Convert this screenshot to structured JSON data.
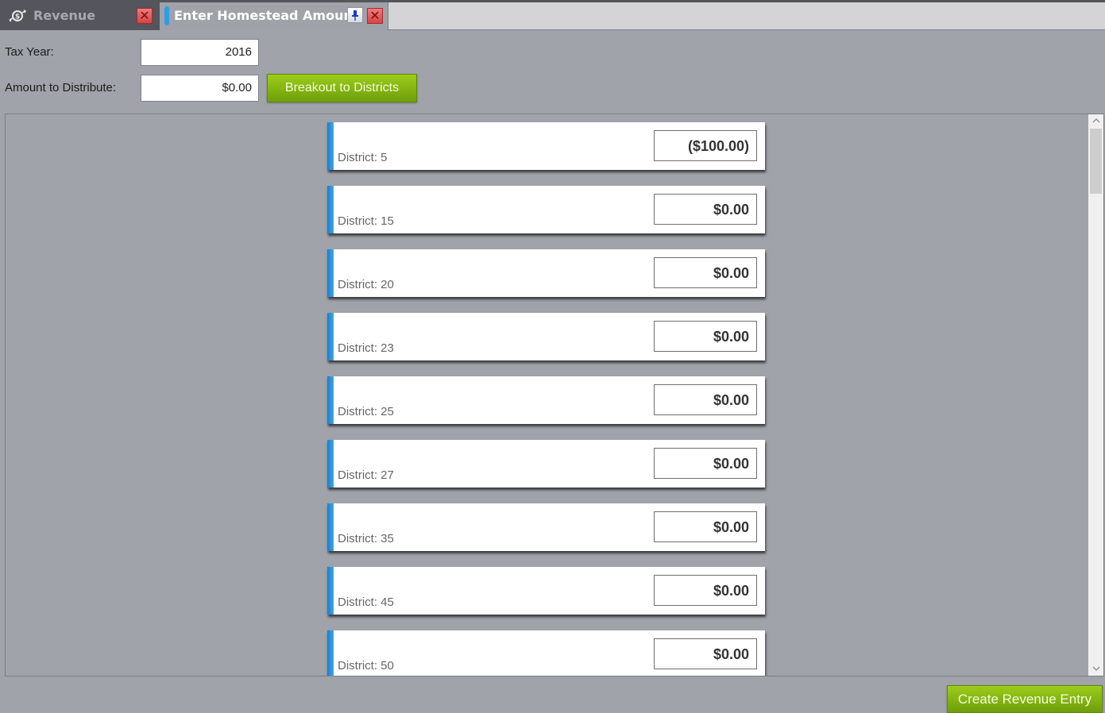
{
  "tabs": [
    {
      "label": "Revenue",
      "icon": "money-transfer-icon",
      "active": false
    },
    {
      "label": "Enter Homestead Amount",
      "icon": "active-tab-indicator",
      "active": true
    }
  ],
  "form": {
    "tax_year_label": "Tax Year:",
    "tax_year_value": "2016",
    "amount_label": "Amount to Distribute:",
    "amount_value": "$0.00",
    "breakout_button": "Breakout to Districts"
  },
  "districts": [
    {
      "label": "District:  5",
      "amount": "($100.00)"
    },
    {
      "label": "District:  15",
      "amount": "$0.00"
    },
    {
      "label": "District:  20",
      "amount": "$0.00"
    },
    {
      "label": "District:  23",
      "amount": "$0.00"
    },
    {
      "label": "District:  25",
      "amount": "$0.00"
    },
    {
      "label": "District:  27",
      "amount": "$0.00"
    },
    {
      "label": "District:  35",
      "amount": "$0.00"
    },
    {
      "label": "District:  45",
      "amount": "$0.00"
    },
    {
      "label": "District:  50",
      "amount": "$0.00"
    }
  ],
  "footer": {
    "create_button": "Create Revenue Entry"
  },
  "icons": {
    "close": "✕",
    "pin": "📌",
    "scroll_up": "︿",
    "scroll_down": "﹀"
  },
  "colors": {
    "accent_blue": "#2a9ee8",
    "button_green": "#8cbf14",
    "background": "#a0a3aa"
  }
}
